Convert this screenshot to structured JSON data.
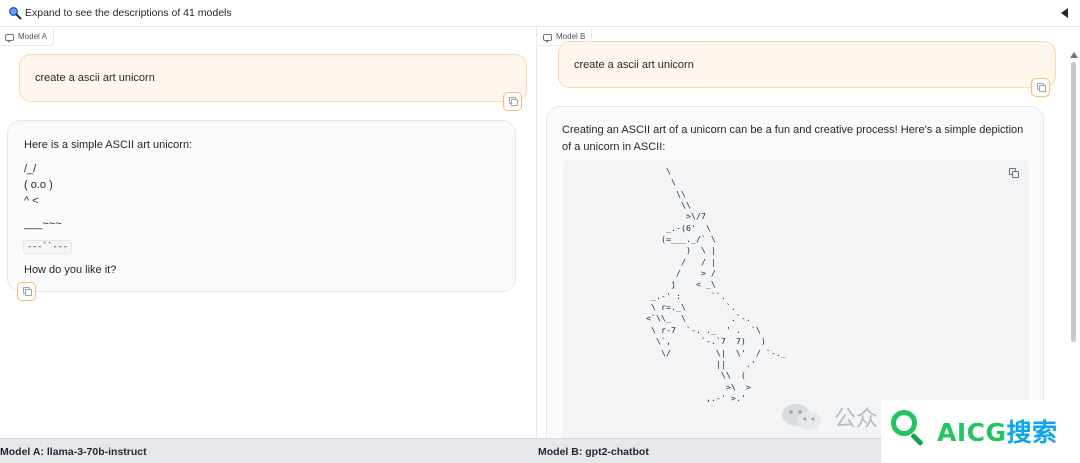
{
  "topbar": {
    "expand_label": "Expand to see the descriptions of 41 models"
  },
  "model_a": {
    "tag": "Model A",
    "user_message": "create a ascii art unicorn",
    "response": {
      "intro": "Here is a simple ASCII art unicorn:",
      "line1": "/_/",
      "line2": "( o.o )",
      "line3": "^ <",
      "line4": "___~~~",
      "code_inline": "---``---",
      "closing": "How do you like it?"
    },
    "footer_label": "Model A: llama-3-70b-instruct"
  },
  "model_b": {
    "tag": "Model B",
    "user_message": "create a ascii art unicorn",
    "response": {
      "intro_line1": "Creating an ASCII art of a unicorn can be a fun and creative process! Here's a simple depiction",
      "intro_line2": "of a unicorn in ASCII:",
      "ascii_art": "    \\\n     \\\n      \\\\\n       \\\\\n        >\\/7\n    _.-(6'  \\\n   (=___._/` \\\n        )  \\ |\n       /   / |\n      /    > /\n     j    < _\\\n _.-' :      ``.\n \\ r=._\\        `.\n<`\\\\_  \\         .`-.\n \\ r-7  `-. ._  ' .  `\\\n  \\`,      `-.`7  7)   )\n   \\/         \\|  \\'  / `-._\n              ||    .'\n               \\\\  (\n                >\\  >\n            ,.-' >.'"
    },
    "footer_label": "Model B: gpt2-chatbot"
  },
  "watermark": {
    "wechat_text": "公众",
    "brand_latin": "AICG",
    "brand_cn": "搜索"
  },
  "colors": {
    "user_bubble_bg": "#fff7ed",
    "user_bubble_border": "#fed7aa",
    "copy_border": "#fdba74",
    "brand_green": "#22c55e",
    "brand_blue": "#0ea5e9"
  },
  "icons": [
    "search-icon",
    "collapse-triangle-icon",
    "chat-icon",
    "copy-icon",
    "wechat-icon"
  ]
}
